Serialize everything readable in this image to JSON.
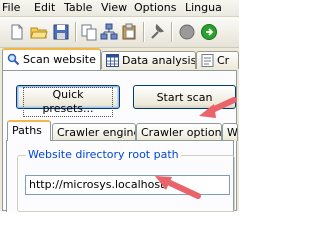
{
  "menu": {
    "items": [
      "File",
      "Edit",
      "Table",
      "View",
      "Options",
      "Lingua"
    ]
  },
  "toolbar": {
    "icons": [
      "new-file-icon",
      "open-folder-icon",
      "save-icon",
      "copy-icon",
      "network-icon",
      "paste-icon",
      "tools-icon",
      "stop-icon",
      "go-icon"
    ]
  },
  "main_tabs": {
    "items": [
      {
        "label": "Scan website",
        "icon": "magnifier-icon",
        "active": true
      },
      {
        "label": "Data analysis",
        "icon": "table-icon",
        "active": false
      },
      {
        "label": "Cr",
        "icon": "page-icon",
        "active": false
      }
    ]
  },
  "actions": {
    "quick_presets": "Quick presets...",
    "start_scan": "Start scan"
  },
  "sub_tabs": {
    "items": [
      {
        "label": "Paths",
        "active": true
      },
      {
        "label": "Crawler engine",
        "active": false
      },
      {
        "label": "Crawler options",
        "active": false
      },
      {
        "label": "W",
        "active": false
      }
    ]
  },
  "paths": {
    "group_title": "Website directory root path",
    "root_path_value": "http://microsys.localhost/"
  },
  "colors": {
    "accent_tab": "#f2b748",
    "group_title": "#0046d5",
    "annotation_arrow": "#e8646a"
  }
}
